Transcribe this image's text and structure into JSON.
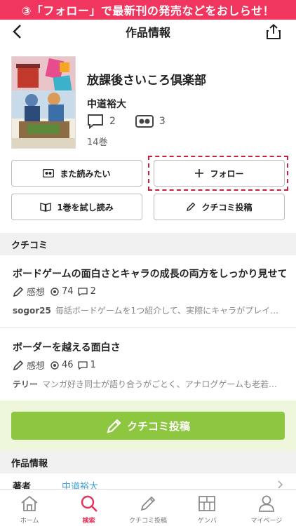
{
  "banner": {
    "text": "③「フォロー」で最新刊の発売などをおしらせ！"
  },
  "navbar": {
    "title": "作品情報"
  },
  "book": {
    "title": "放課後さいころ倶楽部",
    "author": "中道裕大",
    "comment_count": "2",
    "reread_count": "3",
    "volumes": "14巻"
  },
  "actions": {
    "want_to_read": "また読みたい",
    "follow": "フォロー",
    "trial_read": "1巻を試し読み",
    "post_review": "クチコミ投稿"
  },
  "reviews_section": {
    "header": "クチコミ",
    "items": [
      {
        "title": "ボードゲームの面白さとキャラの成長の両方をしっかり見せて…",
        "type": "感想",
        "views": "74",
        "comments": "2",
        "user": "sogor25",
        "snippet": "毎話ボードゲームを1つ紹介して、実際にキャラがプレイ…"
      },
      {
        "title": "ボーダーを越える面白さ",
        "type": "感想",
        "views": "46",
        "comments": "1",
        "user": "テリー",
        "snippet": "マンガ好き同士が語り合うがごとく、アナログゲームも老若…"
      }
    ]
  },
  "post_cta": {
    "label": "クチコミ投稿"
  },
  "info_section": {
    "header": "作品情報",
    "author_key": "著者",
    "author_value": "中道裕大"
  },
  "tabbar": {
    "items": [
      {
        "label": "ホーム",
        "icon": "home-icon"
      },
      {
        "label": "検索",
        "icon": "search-icon"
      },
      {
        "label": "クチコミ投稿",
        "icon": "pencil-icon"
      },
      {
        "label": "ゲンバ",
        "icon": "genba-icon"
      },
      {
        "label": "マイページ",
        "icon": "person-icon"
      }
    ],
    "active": "検索"
  },
  "colors": {
    "accent": "#f0365e",
    "green": "#8dc63f",
    "link": "#3aa0d8"
  }
}
